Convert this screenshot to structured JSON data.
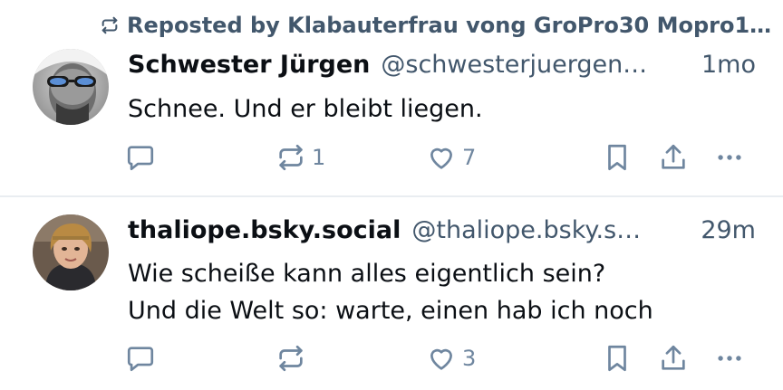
{
  "feed": {
    "posts": [
      {
        "repost_label": "Reposted by Klabauterfrau vong GroPro30 Mopro1…",
        "display_name": "Schwester Jürgen",
        "handle": "@schwesterjuergen…",
        "time": "1mo",
        "text_lines": [
          "Schnee. Und er bleibt liegen."
        ],
        "reply_count": "",
        "repost_count": "1",
        "like_count": "7"
      },
      {
        "display_name": "thaliope.bsky.social",
        "handle": "@thaliope.bsky.s…",
        "time": "29m",
        "text_lines": [
          "Wie scheiße kann alles eigentlich sein?",
          "Und die Welt so: warte, einen hab ich noch"
        ],
        "reply_count": "",
        "repost_count": "",
        "like_count": "3"
      }
    ]
  },
  "colors": {
    "text_primary": "#0b0f14",
    "text_secondary": "#42576c",
    "icon": "#6f869f",
    "divider": "#e9edf1",
    "background": "#ffffff"
  },
  "icons": {
    "repost_indicator": "repost-icon",
    "reply": "reply-icon",
    "repost": "repost-icon",
    "like": "heart-icon",
    "bookmark": "bookmark-icon",
    "share": "share-icon",
    "more": "more-icon"
  }
}
